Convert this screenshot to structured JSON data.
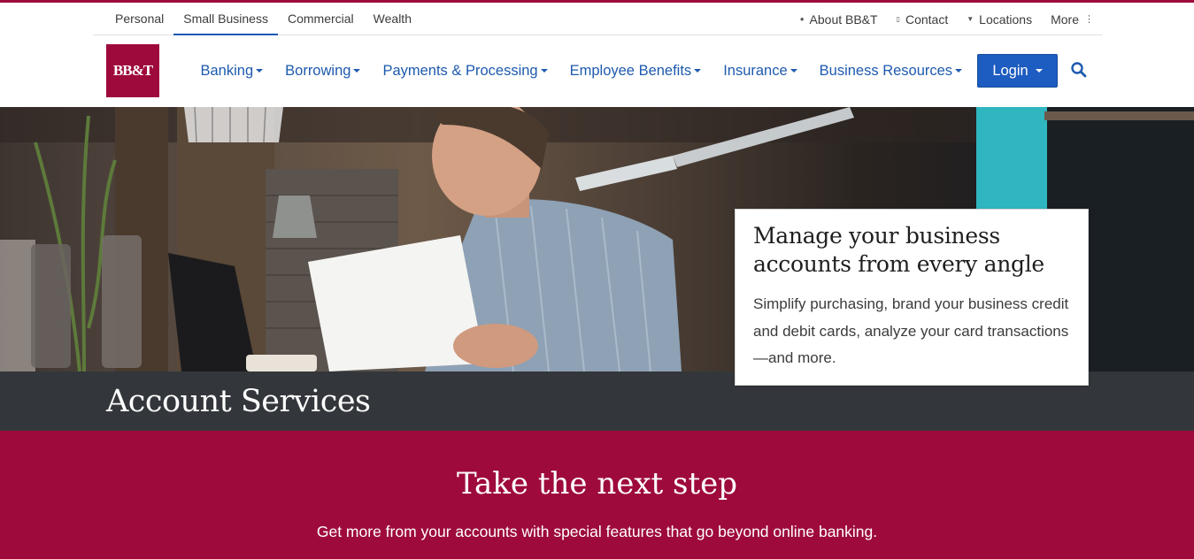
{
  "colors": {
    "brand": "#9e0a3c",
    "link": "#1e5aae",
    "login_bg": "#1d5cc0",
    "band": "#33373b"
  },
  "segments": [
    "Personal",
    "Small Business",
    "Commercial",
    "Wealth"
  ],
  "segments_active": "Small Business",
  "utility": {
    "about": {
      "label": "About BB&T",
      "icon": "person-icon"
    },
    "contact": {
      "label": "Contact",
      "icon": "phone-icon"
    },
    "locations": {
      "label": "Locations",
      "icon": "map-pin-icon"
    },
    "more": {
      "label": "More",
      "icon": "vertical-dots-icon"
    }
  },
  "logo": "BB&T",
  "nav": [
    "Banking",
    "Borrowing",
    "Payments & Processing",
    "Employee Benefits",
    "Insurance",
    "Business Resources"
  ],
  "login": "Login",
  "search_icon": "search-icon",
  "promo": {
    "title": "Manage your business accounts from every angle",
    "body": "Simplify purchasing, brand your business credit and debit cards, analyze your card transactions—and more."
  },
  "band_title": "Account Services",
  "cta": {
    "title": "Take the next step",
    "subtitle": "Get more from your accounts with special features that go beyond online banking."
  }
}
